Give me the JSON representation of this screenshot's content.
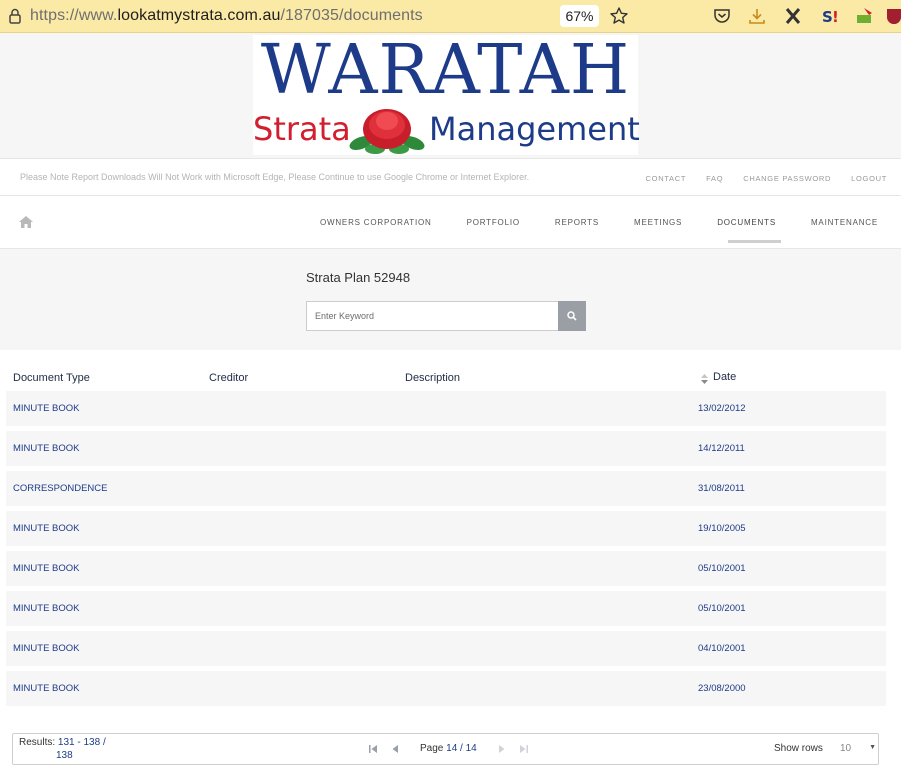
{
  "browser": {
    "url_scheme": "https://www.",
    "url_host": "lookatmystrata.com.au",
    "url_path": "/187035/documents",
    "zoom": "67%"
  },
  "logo": {
    "line1": "WARATAH",
    "strata": "Strata",
    "management": "Management"
  },
  "notice": "Please Note Report Downloads Will Not Work with Microsoft Edge, Please Continue to use Google Chrome or Internet Explorer.",
  "toplinks": [
    "CONTACT",
    "FAQ",
    "CHANGE PASSWORD",
    "LOGOUT"
  ],
  "nav": {
    "items": [
      "OWNERS CORPORATION",
      "PORTFOLIO",
      "REPORTS",
      "MEETINGS",
      "DOCUMENTS",
      "MAINTENANCE"
    ],
    "active": "DOCUMENTS"
  },
  "search": {
    "plan_title": "Strata Plan 52948",
    "placeholder": "Enter Keyword"
  },
  "table": {
    "headers": {
      "type": "Document Type",
      "creditor": "Creditor",
      "description": "Description",
      "date": "Date"
    },
    "rows": [
      {
        "type": "MINUTE BOOK",
        "date": "13/02/2012"
      },
      {
        "type": "MINUTE BOOK",
        "date": "14/12/2011"
      },
      {
        "type": "CORRESPONDENCE",
        "date": "31/08/2011"
      },
      {
        "type": "MINUTE BOOK",
        "date": "19/10/2005"
      },
      {
        "type": "MINUTE BOOK",
        "date": "05/10/2001"
      },
      {
        "type": "MINUTE BOOK",
        "date": "05/10/2001"
      },
      {
        "type": "MINUTE BOOK",
        "date": "04/10/2001"
      },
      {
        "type": "MINUTE BOOK",
        "date": "23/08/2000"
      }
    ]
  },
  "pager": {
    "results_label": "Results:",
    "results_range": "131 - 138 /",
    "results_total": "138",
    "page_label": "Page",
    "page_value": "14 / 14",
    "show_rows_label": "Show rows",
    "rows_per_page": "10"
  }
}
